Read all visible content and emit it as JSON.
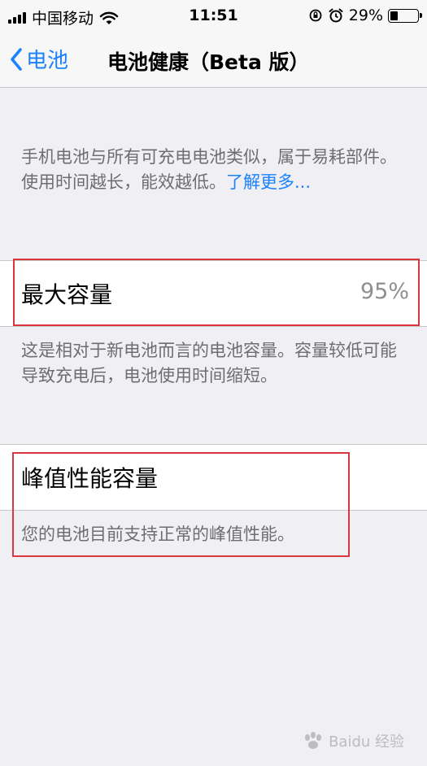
{
  "status_bar": {
    "carrier": "中国移动",
    "time": "11:51",
    "battery_percent_label": "29%",
    "battery_level": 0.29
  },
  "nav": {
    "back_label": "电池",
    "title": "电池健康（Beta 版）"
  },
  "intro": {
    "text": "手机电池与所有可充电电池类似，属于易耗部件。使用时间越长，能效越低。",
    "link": "了解更多..."
  },
  "max_capacity": {
    "label": "最大容量",
    "value": "95%",
    "description": "这是相对于新电池而言的电池容量。容量较低可能导致充电后，电池使用时间缩短。"
  },
  "peak_performance": {
    "label": "峰值性能容量",
    "description": "您的电池目前支持正常的峰值性能。"
  },
  "watermark": {
    "text": "Baidu 经验"
  },
  "colors": {
    "accent": "#1a82fb",
    "background": "#efeff4",
    "secondary_text": "#6d6d72",
    "highlight": "#d9363e"
  }
}
